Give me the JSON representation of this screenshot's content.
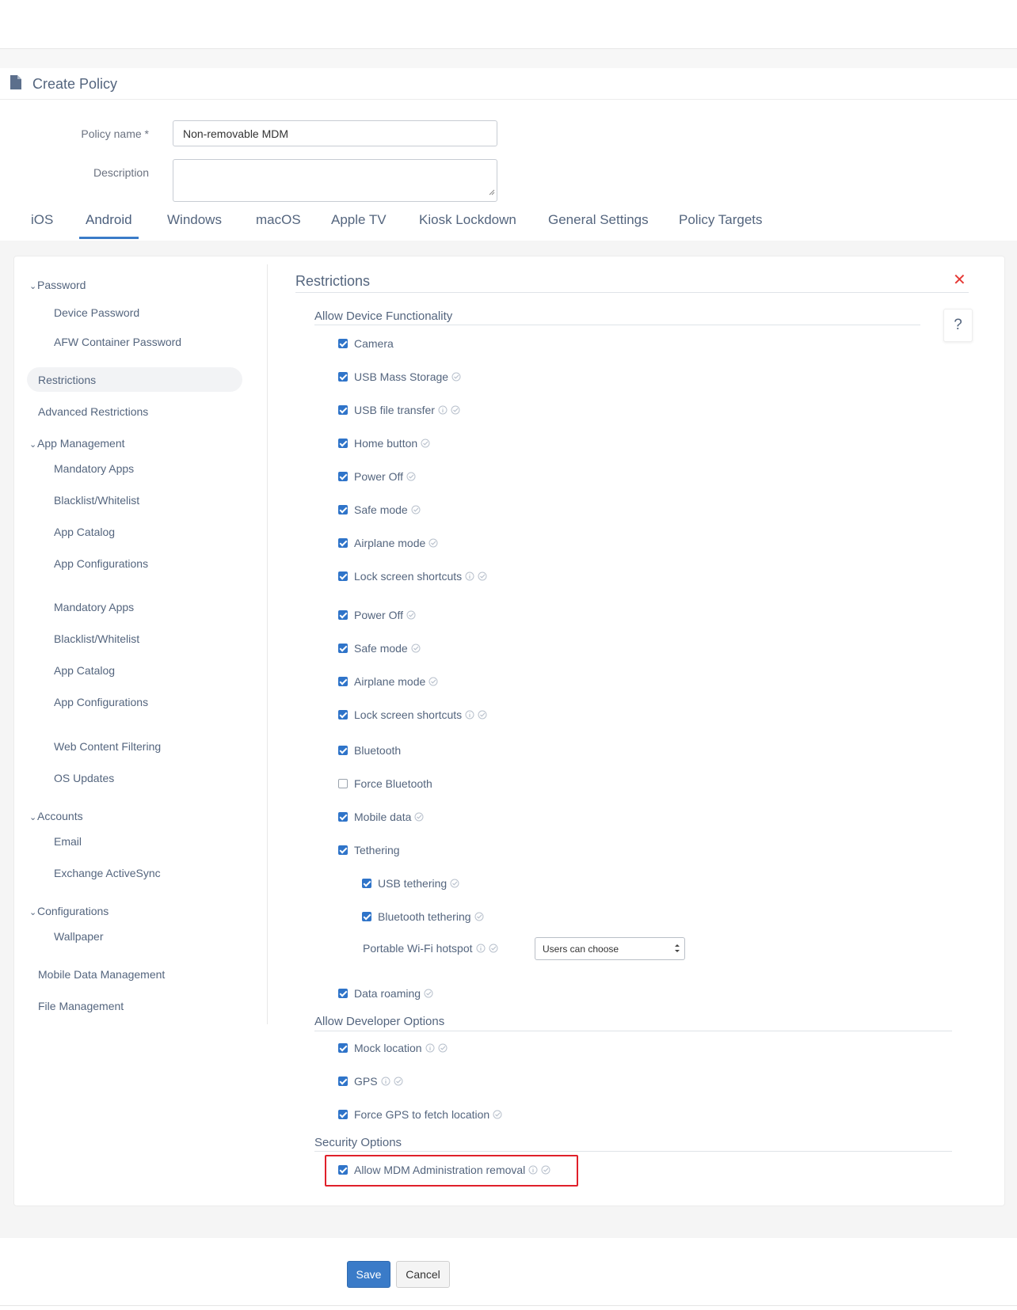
{
  "page": {
    "title": "Create Policy",
    "icon": "document-icon"
  },
  "form": {
    "policy_name_label": "Policy name *",
    "policy_name_value": "Non-removable MDM",
    "description_label": "Description",
    "description_value": ""
  },
  "tabs": [
    "iOS",
    "Android",
    "Windows",
    "macOS",
    "Apple TV",
    "Kiosk Lockdown",
    "General Settings",
    "Policy Targets"
  ],
  "active_tab": "Android",
  "sidebar": {
    "password_group": "Password",
    "device_password": "Device Password",
    "afw_container_password": "AFW Container Password",
    "restrictions": "Restrictions",
    "advanced_restrictions": "Advanced Restrictions",
    "app_management_group": "App Management",
    "mandatory_apps_1": "Mandatory Apps",
    "blacklist_whitelist_1": "Blacklist/Whitelist",
    "app_catalog_1": "App Catalog",
    "app_configurations_1": "App Configurations",
    "mandatory_apps_2": "Mandatory Apps",
    "blacklist_whitelist_2": "Blacklist/Whitelist",
    "app_catalog_2": "App Catalog",
    "app_configurations_2": "App Configurations",
    "web_content_filtering": "Web Content Filtering",
    "os_updates": "OS Updates",
    "accounts_group": "Accounts",
    "email": "Email",
    "exchange_activesync": "Exchange ActiveSync",
    "configurations_group": "Configurations",
    "wallpaper": "Wallpaper",
    "mobile_data_management": "Mobile Data Management",
    "file_management": "File Management"
  },
  "main": {
    "section_title": "Restrictions",
    "help_label": "?",
    "close_icon": "close-icon",
    "groups": {
      "device_functionality": "Allow Device Functionality",
      "developer_options": "Allow Developer Options",
      "security_options": "Security Options"
    },
    "options": {
      "camera": {
        "label": "Camera",
        "checked": true
      },
      "usb_mass_storage": {
        "label": "USB Mass Storage",
        "checked": true
      },
      "usb_file_transfer": {
        "label": "USB file transfer",
        "checked": true
      },
      "home_button": {
        "label": "Home button",
        "checked": true
      },
      "power_off_1": {
        "label": "Power Off",
        "checked": true
      },
      "safe_mode_1": {
        "label": "Safe mode",
        "checked": true
      },
      "airplane_mode_1": {
        "label": "Airplane mode",
        "checked": true
      },
      "lock_screen_shortcuts_1": {
        "label": "Lock screen shortcuts",
        "checked": true
      },
      "power_off_2": {
        "label": "Power Off",
        "checked": true
      },
      "safe_mode_2": {
        "label": "Safe mode",
        "checked": true
      },
      "airplane_mode_2": {
        "label": "Airplane mode",
        "checked": true
      },
      "lock_screen_shortcuts_2": {
        "label": "Lock screen shortcuts",
        "checked": true
      },
      "bluetooth": {
        "label": "Bluetooth",
        "checked": true
      },
      "force_bluetooth": {
        "label": "Force Bluetooth",
        "checked": false
      },
      "mobile_data": {
        "label": "Mobile data",
        "checked": true
      },
      "tethering": {
        "label": "Tethering",
        "checked": true
      },
      "usb_tethering": {
        "label": "USB tethering",
        "checked": true
      },
      "bluetooth_tethering": {
        "label": "Bluetooth tethering",
        "checked": true
      },
      "data_roaming": {
        "label": "Data roaming",
        "checked": true
      },
      "mock_location": {
        "label": "Mock location",
        "checked": true
      },
      "gps": {
        "label": "GPS",
        "checked": true
      },
      "force_gps": {
        "label": "Force GPS to fetch location",
        "checked": true
      },
      "allow_mdm_removal": {
        "label": "Allow MDM Administration removal",
        "checked": true
      }
    },
    "hotspot": {
      "label": "Portable Wi-Fi hotspot",
      "selected": "Users can choose"
    }
  },
  "footer": {
    "save_label": "Save",
    "cancel_label": "Cancel"
  },
  "colors": {
    "accent": "#3a7bc8",
    "checkbox": "#2f74c9",
    "highlight": "#e0202a",
    "close": "#e53935"
  }
}
